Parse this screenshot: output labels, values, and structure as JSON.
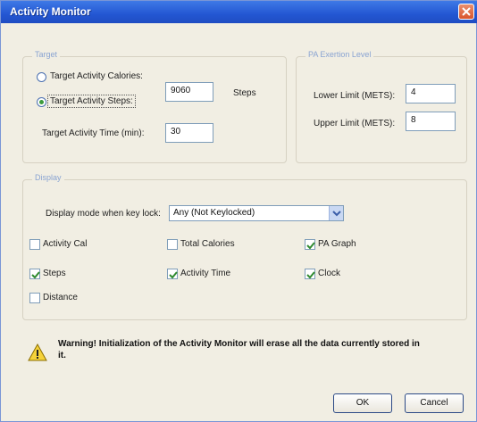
{
  "window": {
    "title": "Activity Monitor"
  },
  "target": {
    "legend": "Target",
    "calories_label": "Target Activity Calories:",
    "steps_label": "Target Activity Steps:",
    "steps_value": "9060",
    "steps_unit": "Steps",
    "time_label": "Target Activity Time (min):",
    "time_value": "30",
    "selected": "steps"
  },
  "pa_level": {
    "legend": "PA Exertion Level",
    "lower_label": "Lower Limit (METS):",
    "lower_value": "4",
    "upper_label": "Upper Limit (METS):",
    "upper_value": "8"
  },
  "display": {
    "legend": "Display",
    "mode_label": "Display mode when key lock:",
    "mode_value": "Any (Not Keylocked)",
    "checkboxes": {
      "activity_cal": {
        "label": "Activity Cal",
        "checked": false
      },
      "total_calories": {
        "label": "Total Calories",
        "checked": false
      },
      "pa_graph": {
        "label": "PA Graph",
        "checked": true
      },
      "steps": {
        "label": "Steps",
        "checked": true
      },
      "activity_time": {
        "label": "Activity Time",
        "checked": true
      },
      "clock": {
        "label": "Clock",
        "checked": true
      },
      "distance": {
        "label": "Distance",
        "checked": false
      }
    }
  },
  "warning": {
    "line1": "Warning! Initialization of the Activity Monitor will erase all the data currently stored in",
    "line2": "it."
  },
  "buttons": {
    "ok": "OK",
    "cancel": "Cancel"
  }
}
